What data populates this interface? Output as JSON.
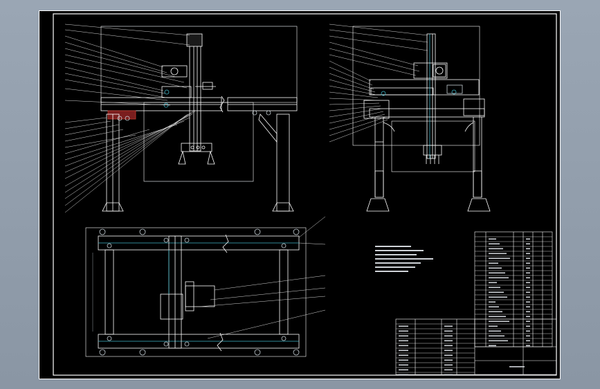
{
  "colors": {
    "background": "#8e9aa8",
    "paper": "#000000",
    "line": "#ffffff",
    "leader": "#d8d8d8",
    "part": "#c8d2d8",
    "accent_red": "#c0392b",
    "accent_cyan": "#3fb6c8",
    "dim": "#9aa0a6"
  },
  "zone_letters": [
    "",
    "",
    "",
    "",
    "",
    "",
    ""
  ]
}
